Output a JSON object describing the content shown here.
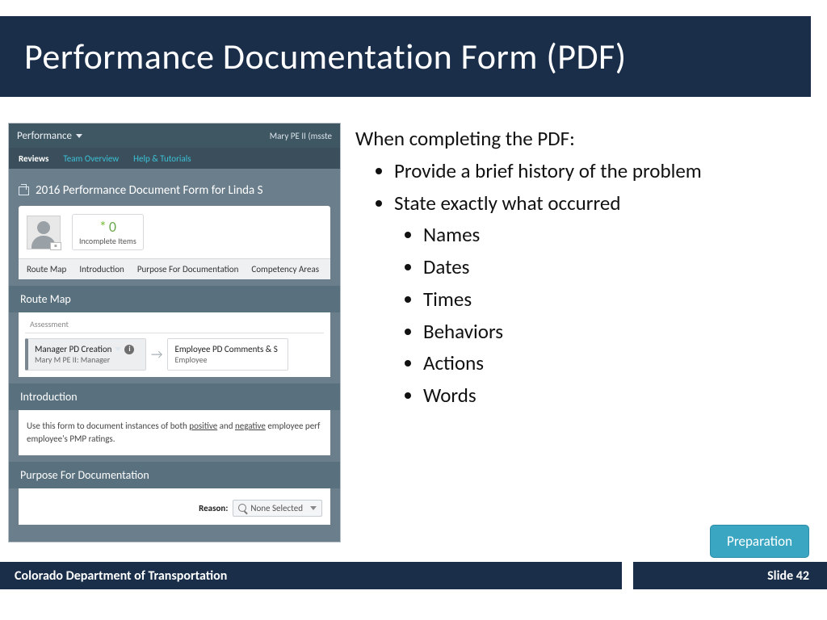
{
  "title": "Performance Documentation Form (PDF)",
  "content": {
    "lead": "When completing the PDF:",
    "b1": "Provide a brief history of the problem",
    "b2": "State exactly what occurred",
    "sub": {
      "names": "Names",
      "dates": "Dates",
      "times": "Times",
      "behaviors": "Behaviors",
      "actions": "Actions",
      "words": "Words"
    }
  },
  "pill": "Preparation",
  "footer": {
    "org": "Colorado Department of Transportation",
    "slide": "Slide 42"
  },
  "app": {
    "menu": "Performance",
    "user": "Mary PE II (msste",
    "tabs": {
      "reviews": "Reviews",
      "team": "Team Overview",
      "help": "Help & Tutorials"
    },
    "heading": "2016 Performance Document Form for Linda S",
    "incomplete": {
      "value": "0",
      "label": "Incomplete Items"
    },
    "subtabs": {
      "route": "Route Map",
      "intro": "Introduction",
      "purpose": "Purpose For Documentation",
      "comp": "Competency Areas"
    },
    "route": {
      "header": "Route Map",
      "assessment": "Assessment",
      "step1": {
        "title": "Manager PD Creation",
        "sub": "Mary M PE II: Manager"
      },
      "step2": {
        "title": "Employee PD Comments & S",
        "sub": "Employee"
      }
    },
    "intro": {
      "header": "Introduction",
      "pre": "Use this form to document instances of both ",
      "pos": "positive",
      "mid": " and ",
      "neg": "negative",
      "post": " employee perf",
      "line2": "employee's PMP ratings."
    },
    "purpose": {
      "header": "Purpose For Documentation",
      "reason_label": "Reason:",
      "dd": "None Selected"
    }
  }
}
